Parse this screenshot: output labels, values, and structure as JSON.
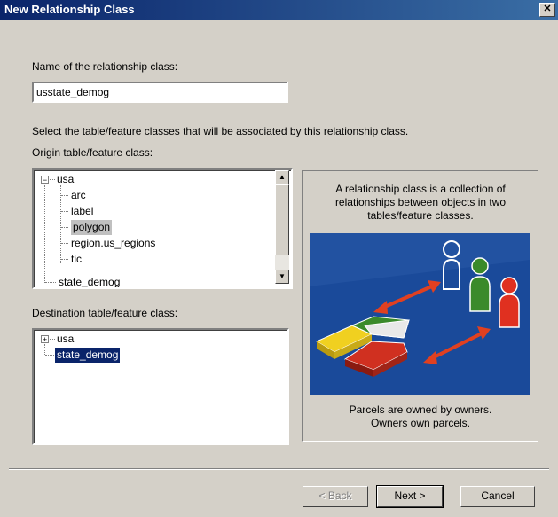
{
  "window": {
    "title": "New Relationship Class",
    "close_glyph": "✕"
  },
  "name_section": {
    "label": "Name of the relationship class:",
    "value": "usstate_demog"
  },
  "instructions": "Select the table/feature classes that will be associated by this relationship class.",
  "origin": {
    "label": "Origin table/feature class:",
    "root": {
      "label": "usa",
      "expander": "−"
    },
    "children": [
      "arc",
      "label",
      "polygon",
      "region.us_regions",
      "tic"
    ],
    "selected": "polygon",
    "partial_item": "state_demog"
  },
  "destination": {
    "label": "Destination table/feature class:",
    "root": {
      "label": "usa",
      "expander": "+"
    },
    "selected": "state_demog"
  },
  "info_panel": {
    "description": "A relationship class is a collection of relationships between objects in two tables/feature classes.",
    "caption_line1": "Parcels are owned by owners.",
    "caption_line2": "Owners own parcels."
  },
  "buttons": {
    "back": "< Back",
    "next": "Next >",
    "cancel": "Cancel"
  },
  "scroll_glyphs": {
    "up": "▲",
    "down": "▼"
  },
  "colors": {
    "illustration_bg": "#1a4a9a",
    "arrow": "#e04020",
    "owner_white": "#ffffff",
    "owner_green": "#3a8a2a",
    "owner_red": "#e03020",
    "parcel_yellow": "#f0d020",
    "parcel_green": "#3a8a2a",
    "parcel_red": "#d03020"
  }
}
